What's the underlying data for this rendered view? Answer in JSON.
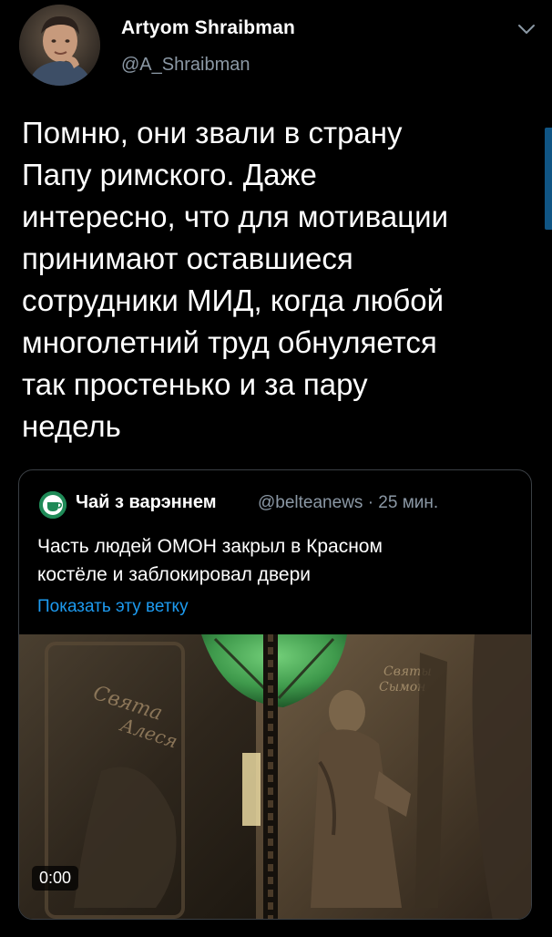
{
  "author": {
    "name": "Artyom Shraibman",
    "handle": "@A_Shraibman"
  },
  "icons": {
    "avatar": "profile-photo",
    "more": "chevron-down-icon",
    "quote_avatar": "green-round-logo"
  },
  "tweet": {
    "text": "Помню, они звали в страну\nПапу римского. Даже\nинтересно, что для мотивации\nпринимают оставшиеся\nсотрудники МИД, когда любой\nмноголетний труд обнуляется\nтак простенько и за пару\nнедель"
  },
  "quote": {
    "name": "Чай з варэннем",
    "meta": "@belteanews · 25 мин.",
    "text": "Часть людей ОМОН закрыл в Красном\nкостёле и заблокировал двери",
    "show_thread": "Показать эту ветку",
    "video_time": "0:00"
  },
  "colors": {
    "background": "#000000",
    "secondary_text": "#8b98a5",
    "link": "#1d9bf0",
    "card_border": "#3a3f44"
  }
}
